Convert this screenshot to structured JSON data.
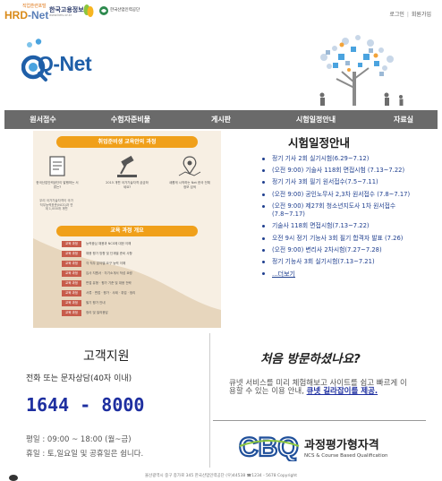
{
  "header": {
    "hrd_small": "직업훈련포털",
    "hrd_logo_a": "HRD",
    "hrd_logo_b": "-Net",
    "org1_name": "한국고용정보원",
    "org1_url": "www.keis.or.kr",
    "org2_name": "한국산업인력공단",
    "login": "로그인",
    "signup": "회원가입"
  },
  "brand": {
    "qnet": "Q-Net"
  },
  "nav": {
    "items": [
      "원서접수",
      "수험자준비물",
      "게시판",
      "시험일정안내",
      "자료실"
    ]
  },
  "banner": {
    "ribbon1": "취업준비생 교육안의 과정",
    "card1": "한국산업인력공단이 발행하는 서류는?",
    "card2": "2015 개편 국가기술자격 궁금하세요?",
    "card3": "새롭게 시작하는 Net 한국 전체 정보 검색",
    "side_note": "우리 국가기술자격이 국가직무능력표준(NCS)과 연계 1,000개 개편",
    "ribbon2": "교육 과정 개요",
    "courses": [
      {
        "tag": "교육 과정",
        "text": "능력중심 채용과 NCS에 대한 이해"
      },
      {
        "tag": "교육 과정",
        "text": "채용 평가 방향 및 단계별 준비 사항"
      },
      {
        "tag": "교육 과정",
        "text": "각 직무 분야별 요구 능력 이해"
      },
      {
        "tag": "교육 과정",
        "text": "입사 지원서 · 자기소개서 작성 요령"
      },
      {
        "tag": "교육 과정",
        "text": "면접 유형 · 평가 기준 및 대응 전략"
      },
      {
        "tag": "교육 과정",
        "text": "서류 · 면접 · 평가 · 사례 · 취업 · 정리"
      },
      {
        "tag": "교육 과정",
        "text": "필기 평가 안내"
      },
      {
        "tag": "교육 과정",
        "text": "정리 및 질의응답"
      }
    ]
  },
  "schedule": {
    "title": "시험일정안내",
    "items": [
      "정기 기사 2회 실기시험(6.29~7.12)",
      "(오전 9:00) 기술사 118회 면접시험 (7.13~7.22)",
      "정기 기사 3회 필기 원서접수(7.5~7.11)",
      "(오전 9:00) 공인노무사 2,3차 원서접수 (7.8~7.17)",
      "(오전 9:00) 제27회 청소년지도사 1차 원서접수 (7.8~7.17)",
      "기술사 118회 면접시험(7.13~7.22)",
      "오전 9시 정기 기능사 3회 필기 합격자 발표 (7.26)",
      "(오전 9:00) 변리사 2차시험(7.27~7.28)",
      "정기 기능사 3회 실기시험(7.13~7.21)"
    ],
    "more": "...더보기"
  },
  "support": {
    "title": "고객지원",
    "subtitle": "전화 또는 문자상담(40자 이내)",
    "phone": "1644 - 8000",
    "hours_weekday": "평일 : 09:00 ~ 18:00 (월~금)",
    "hours_holiday": "휴일 : 토,일요일 및 공휴일은 쉽니다."
  },
  "first_visit": {
    "title": "처음 방문하셨나요?",
    "text": "큐넷 서비스를 미리 체험해보고 사이트를 쉽고 빠르게 이용할 수 있는 이용 안내, ",
    "link": "큐넷 길라잡이를 제공."
  },
  "cbq": {
    "logo": "CBQ",
    "title": "과정평가형자격",
    "subtitle": "NCS & Course Based Qualification"
  },
  "footer": {
    "text": "울산광역시 중구 종가로 345 한국산업인력공단 (우)44538 ☎1234 - 5678 Copyright"
  },
  "colors": {
    "nav_bg": "#6a6a6a",
    "brand_blue": "#1f5fa8",
    "phone_blue": "#1e2fa0",
    "banner_orange": "#f0a01a",
    "course_tag": "#c75c4b"
  }
}
